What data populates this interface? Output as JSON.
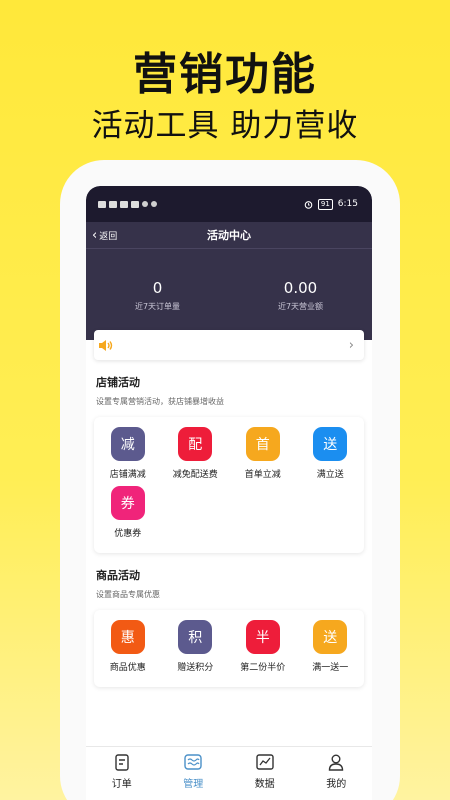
{
  "promo": {
    "title": "营销功能",
    "subtitle": "活动工具 助力营收"
  },
  "status_bar": {
    "battery": "91",
    "time": "6:15"
  },
  "nav": {
    "back_label": "返回",
    "title": "活动中心"
  },
  "stats": [
    {
      "value": "0",
      "label": "近7天订单量"
    },
    {
      "value": "0.00",
      "label": "近7天营业额"
    }
  ],
  "shop_section": {
    "title": "店铺活动",
    "desc": "设置专属营销活动，获店铺暴增收益",
    "tools": [
      {
        "glyph": "减",
        "label": "店铺满减",
        "color": "#5c5a8e"
      },
      {
        "glyph": "配",
        "label": "减免配送费",
        "color": "#ee1d3a"
      },
      {
        "glyph": "首",
        "label": "首单立减",
        "color": "#f6a81e"
      },
      {
        "glyph": "送",
        "label": "满立送",
        "color": "#1b8ef0"
      },
      {
        "glyph": "券",
        "label": "优惠券",
        "color": "#f0247a"
      }
    ]
  },
  "goods_section": {
    "title": "商品活动",
    "desc": "设置商品专属优惠",
    "tools": [
      {
        "glyph": "惠",
        "label": "商品优惠",
        "color": "#f25a14"
      },
      {
        "glyph": "积",
        "label": "赠送积分",
        "color": "#5c5a8e"
      },
      {
        "glyph": "半",
        "label": "第二份半价",
        "color": "#ee1d3a"
      },
      {
        "glyph": "送",
        "label": "满一送一",
        "color": "#f6a81e"
      }
    ]
  },
  "tabs": [
    {
      "label": "订单",
      "icon": "order-icon",
      "active": false
    },
    {
      "label": "管理",
      "icon": "manage-icon",
      "active": true
    },
    {
      "label": "数据",
      "icon": "chart-icon",
      "active": false
    },
    {
      "label": "我的",
      "icon": "user-icon",
      "active": false
    }
  ],
  "colors": {
    "background": "#ffe83a",
    "header": "#36324a",
    "tab_active": "#4a90c8",
    "speaker": "#f6a81e"
  }
}
